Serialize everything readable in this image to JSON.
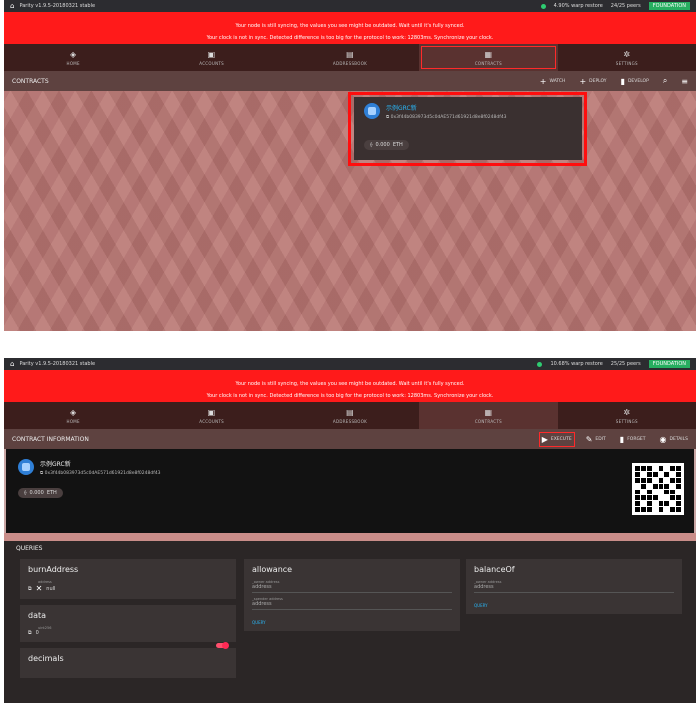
{
  "app": {
    "title": "Parity v1.9.5-20180321 stable",
    "title2": "Parity v1.9.5-20180321 stable"
  },
  "status1": {
    "sync": "4.90% warp restore",
    "peers": "24/25 peers",
    "badge": "FOUNDATION"
  },
  "status2": {
    "sync": "10.68% warp restore",
    "peers": "25/25 peers",
    "badge": "FOUNDATION"
  },
  "warning": {
    "line1": "Your node is still syncing, the values you see might be outdated. Wait until it's fully synced.",
    "line2a": "Your clock is not in sync. Detected difference is too big for the protocol to work: 12803ms. Synchronize your clock.",
    "line2b": "Your clock is not in sync. Detected difference is too big for the protocol to work: 12803ms. Synchronize your clock."
  },
  "nav": {
    "home": "HOME",
    "accounts": "ACCOUNTS",
    "addressbook": "ADDRESSBOOK",
    "contracts": "CONTRACTS",
    "settings": "SETTINGS"
  },
  "page1": {
    "title": "CONTRACTS",
    "actions": {
      "watch": "WATCH",
      "deploy": "DEPLOY",
      "develop": "DEVELOP"
    }
  },
  "contract": {
    "name": "示例GRC新",
    "address": "0x3f44b083973d5c0dAE571d61921d8e8f0248df43",
    "balance": "0.000",
    "unit": "ETH"
  },
  "page2": {
    "title": "CONTRACT INFORMATION",
    "actions": {
      "execute": "EXECUTE",
      "edit": "EDIT",
      "forget": "FORGET",
      "details": "DETAILS"
    }
  },
  "queries": {
    "title": "QUERIES",
    "burnAddress": {
      "name": "burnAddress",
      "label": "address",
      "value": "null"
    },
    "allowance": {
      "name": "allowance",
      "owner_label": "_owner address",
      "owner_ph": "address",
      "spender_label": "_spender address",
      "spender_ph": "address",
      "button": "QUERY"
    },
    "balanceOf": {
      "name": "balanceOf",
      "owner_label": "_owner address",
      "owner_ph": "address",
      "button": "QUERY"
    },
    "data": {
      "name": "data",
      "label": "uint256",
      "value": "0"
    },
    "decimals": {
      "name": "decimals"
    }
  },
  "icons": {
    "logo": "parity-icon",
    "home": "home-icon",
    "accounts": "accounts-icon",
    "addressbook": "addressbook-icon",
    "contracts": "contracts-icon",
    "settings": "gear-icon"
  },
  "colors": {
    "warning": "#ff1a1a",
    "accent": "#29b6f6",
    "badge": "#27ae60",
    "highlight": "#ff0e0e"
  }
}
